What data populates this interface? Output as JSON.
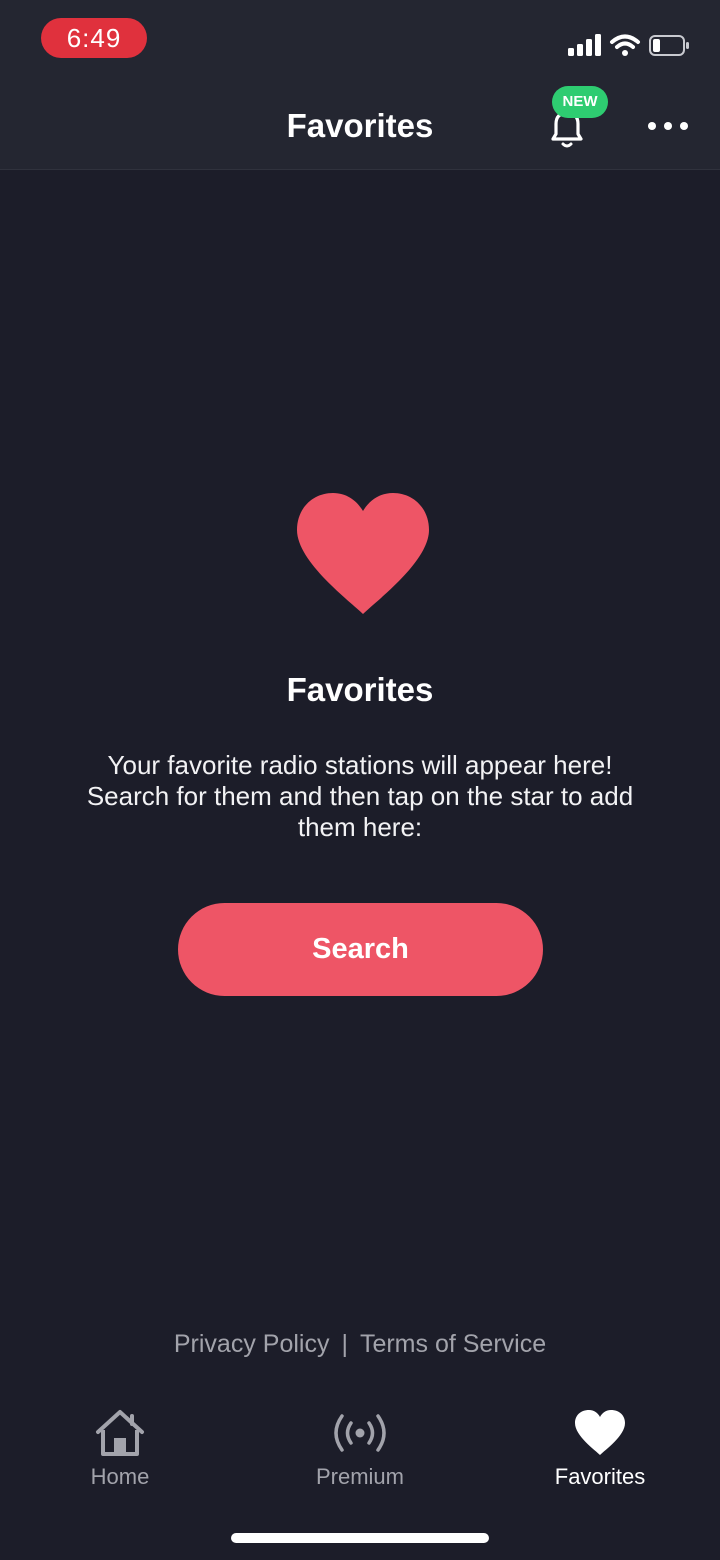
{
  "status_bar": {
    "time": "6:49",
    "battery_level": 0.25
  },
  "header": {
    "title": "Favorites",
    "notification_badge": "NEW",
    "icons": [
      "bell-icon",
      "more-icon"
    ]
  },
  "empty_state": {
    "icon": "heart-icon",
    "title": "Favorites",
    "description": "Your favorite radio stations will appear here! Search for them and then tap on the star to add them here:",
    "button_label": "Search"
  },
  "footer_links": {
    "privacy": "Privacy Policy",
    "separator": "|",
    "terms": "Terms of Service"
  },
  "tab_bar": {
    "active": "Favorites",
    "tabs": [
      {
        "label": "Home",
        "icon": "home-icon"
      },
      {
        "label": "Premium",
        "icon": "broadcast-icon"
      },
      {
        "label": "Favorites",
        "icon": "heart-icon"
      }
    ]
  },
  "colors": {
    "background": "#1c1d29",
    "header_background": "#242631",
    "accent": "#ee5566",
    "badge": "#2ecc71",
    "time_pill": "#e0313d",
    "muted_text": "#a2a3ab"
  }
}
